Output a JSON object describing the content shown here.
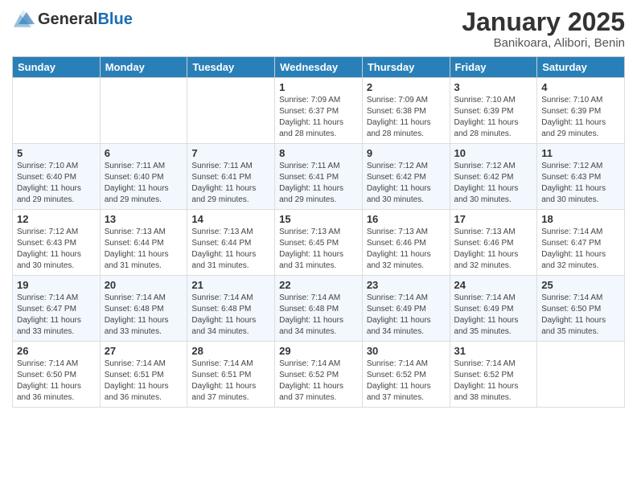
{
  "header": {
    "logo_general": "General",
    "logo_blue": "Blue",
    "month_title": "January 2025",
    "location": "Banikoara, Alibori, Benin"
  },
  "days_of_week": [
    "Sunday",
    "Monday",
    "Tuesday",
    "Wednesday",
    "Thursday",
    "Friday",
    "Saturday"
  ],
  "weeks": [
    [
      {
        "day": "",
        "info": ""
      },
      {
        "day": "",
        "info": ""
      },
      {
        "day": "",
        "info": ""
      },
      {
        "day": "1",
        "sunrise": "7:09 AM",
        "sunset": "6:37 PM",
        "daylight": "11 hours and 28 minutes."
      },
      {
        "day": "2",
        "sunrise": "7:09 AM",
        "sunset": "6:38 PM",
        "daylight": "11 hours and 28 minutes."
      },
      {
        "day": "3",
        "sunrise": "7:10 AM",
        "sunset": "6:39 PM",
        "daylight": "11 hours and 28 minutes."
      },
      {
        "day": "4",
        "sunrise": "7:10 AM",
        "sunset": "6:39 PM",
        "daylight": "11 hours and 29 minutes."
      }
    ],
    [
      {
        "day": "5",
        "sunrise": "7:10 AM",
        "sunset": "6:40 PM",
        "daylight": "11 hours and 29 minutes."
      },
      {
        "day": "6",
        "sunrise": "7:11 AM",
        "sunset": "6:40 PM",
        "daylight": "11 hours and 29 minutes."
      },
      {
        "day": "7",
        "sunrise": "7:11 AM",
        "sunset": "6:41 PM",
        "daylight": "11 hours and 29 minutes."
      },
      {
        "day": "8",
        "sunrise": "7:11 AM",
        "sunset": "6:41 PM",
        "daylight": "11 hours and 29 minutes."
      },
      {
        "day": "9",
        "sunrise": "7:12 AM",
        "sunset": "6:42 PM",
        "daylight": "11 hours and 30 minutes."
      },
      {
        "day": "10",
        "sunrise": "7:12 AM",
        "sunset": "6:42 PM",
        "daylight": "11 hours and 30 minutes."
      },
      {
        "day": "11",
        "sunrise": "7:12 AM",
        "sunset": "6:43 PM",
        "daylight": "11 hours and 30 minutes."
      }
    ],
    [
      {
        "day": "12",
        "sunrise": "7:12 AM",
        "sunset": "6:43 PM",
        "daylight": "11 hours and 30 minutes."
      },
      {
        "day": "13",
        "sunrise": "7:13 AM",
        "sunset": "6:44 PM",
        "daylight": "11 hours and 31 minutes."
      },
      {
        "day": "14",
        "sunrise": "7:13 AM",
        "sunset": "6:44 PM",
        "daylight": "11 hours and 31 minutes."
      },
      {
        "day": "15",
        "sunrise": "7:13 AM",
        "sunset": "6:45 PM",
        "daylight": "11 hours and 31 minutes."
      },
      {
        "day": "16",
        "sunrise": "7:13 AM",
        "sunset": "6:46 PM",
        "daylight": "11 hours and 32 minutes."
      },
      {
        "day": "17",
        "sunrise": "7:13 AM",
        "sunset": "6:46 PM",
        "daylight": "11 hours and 32 minutes."
      },
      {
        "day": "18",
        "sunrise": "7:14 AM",
        "sunset": "6:47 PM",
        "daylight": "11 hours and 32 minutes."
      }
    ],
    [
      {
        "day": "19",
        "sunrise": "7:14 AM",
        "sunset": "6:47 PM",
        "daylight": "11 hours and 33 minutes."
      },
      {
        "day": "20",
        "sunrise": "7:14 AM",
        "sunset": "6:48 PM",
        "daylight": "11 hours and 33 minutes."
      },
      {
        "day": "21",
        "sunrise": "7:14 AM",
        "sunset": "6:48 PM",
        "daylight": "11 hours and 34 minutes."
      },
      {
        "day": "22",
        "sunrise": "7:14 AM",
        "sunset": "6:48 PM",
        "daylight": "11 hours and 34 minutes."
      },
      {
        "day": "23",
        "sunrise": "7:14 AM",
        "sunset": "6:49 PM",
        "daylight": "11 hours and 34 minutes."
      },
      {
        "day": "24",
        "sunrise": "7:14 AM",
        "sunset": "6:49 PM",
        "daylight": "11 hours and 35 minutes."
      },
      {
        "day": "25",
        "sunrise": "7:14 AM",
        "sunset": "6:50 PM",
        "daylight": "11 hours and 35 minutes."
      }
    ],
    [
      {
        "day": "26",
        "sunrise": "7:14 AM",
        "sunset": "6:50 PM",
        "daylight": "11 hours and 36 minutes."
      },
      {
        "day": "27",
        "sunrise": "7:14 AM",
        "sunset": "6:51 PM",
        "daylight": "11 hours and 36 minutes."
      },
      {
        "day": "28",
        "sunrise": "7:14 AM",
        "sunset": "6:51 PM",
        "daylight": "11 hours and 37 minutes."
      },
      {
        "day": "29",
        "sunrise": "7:14 AM",
        "sunset": "6:52 PM",
        "daylight": "11 hours and 37 minutes."
      },
      {
        "day": "30",
        "sunrise": "7:14 AM",
        "sunset": "6:52 PM",
        "daylight": "11 hours and 37 minutes."
      },
      {
        "day": "31",
        "sunrise": "7:14 AM",
        "sunset": "6:52 PM",
        "daylight": "11 hours and 38 minutes."
      },
      {
        "day": "",
        "info": ""
      }
    ]
  ],
  "labels": {
    "sunrise_prefix": "Sunrise: ",
    "sunset_prefix": "Sunset: ",
    "daylight_prefix": "Daylight: "
  }
}
